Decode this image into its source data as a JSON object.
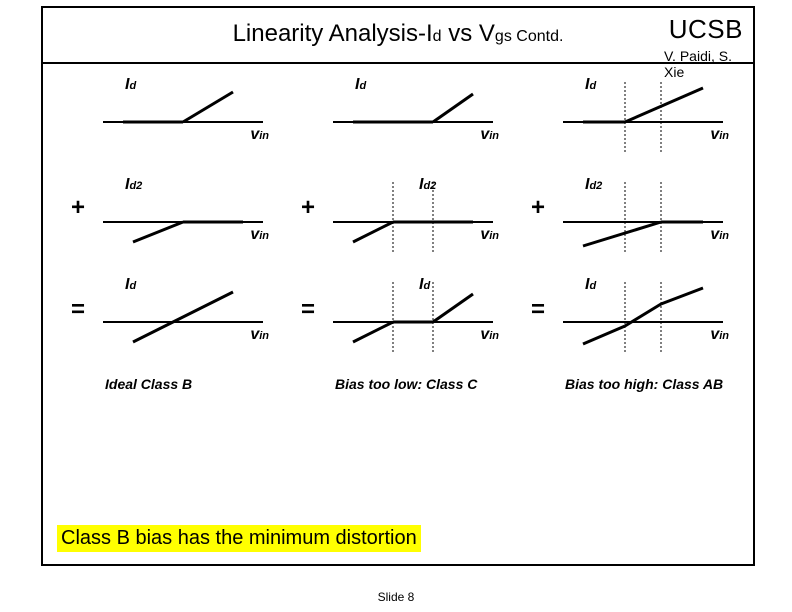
{
  "header": {
    "title_main": "Linearity Analysis-I",
    "title_sub1": "d",
    "title_mid": " vs V",
    "title_sub2": "gs Contd.",
    "ucsb": "UCSB",
    "authors": "V. Paidi, S. Xie"
  },
  "labels": {
    "id": "I",
    "id_sub": "d",
    "id2": "I",
    "id2_sub": "d2",
    "vin": "v",
    "vin_sub": "in"
  },
  "ops": {
    "plus": "+",
    "eq": "="
  },
  "captions": {
    "col1": "Ideal Class B",
    "col2": "Bias too low: Class C",
    "col3": "Bias too high: Class AB"
  },
  "note": "Class B bias has the minimum distortion",
  "footer": "Slide 8",
  "chart_data": {
    "type": "line",
    "description": "Nine qualitative piecewise-linear sketches of drain current vs input voltage arranged in 3 columns × 3 rows. Columns are bias conditions; rows are Id, Id2 (complementary), and Id (sum). No numeric scales.",
    "columns": [
      {
        "name": "Ideal Class B",
        "knee_offset": 0
      },
      {
        "name": "Bias too low: Class C",
        "knee_offset": 0.2
      },
      {
        "name": "Bias too high: Class AB",
        "knee_offset": -0.15
      }
    ],
    "rows": [
      {
        "name": "Id",
        "shape": "zero-for-x<knee, positive slope for x>knee"
      },
      {
        "name": "Id2",
        "shape": "negative slope for x<knee, zero for x>knee (mirror)"
      },
      {
        "name": "Id (sum)",
        "shape": "column-dependent: linear / dead-zone / overlap-kink"
      }
    ],
    "xlabel": "vin",
    "ylabel": "Id / Id2",
    "axes_numeric": false
  }
}
